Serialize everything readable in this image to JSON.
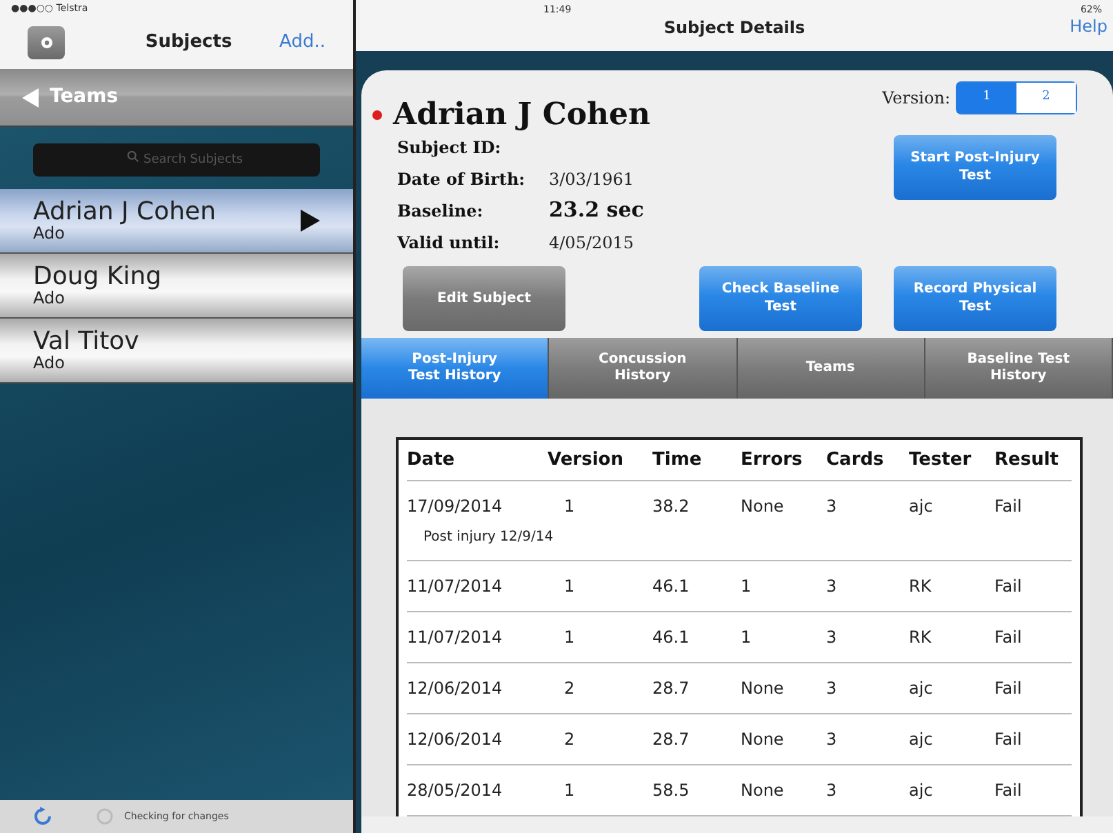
{
  "status_bar": {
    "carrier": "●●●○○ Telstra",
    "time": "11:49",
    "battery": "62%"
  },
  "sidebar": {
    "title": "Subjects",
    "add_button": "Add..",
    "back_button": "Teams",
    "search": {
      "placeholder": "Search Subjects"
    },
    "subjects": [
      {
        "name": "Adrian J Cohen",
        "team": "Ado",
        "selected": true
      },
      {
        "name": "Doug King",
        "team": "Ado",
        "selected": false
      },
      {
        "name": "Val Titov",
        "team": "Ado",
        "selected": false
      }
    ],
    "footer": {
      "status": "Checking for changes"
    }
  },
  "detail": {
    "title": "Subject Details",
    "help": "Help",
    "subject_name": "Adrian J Cohen",
    "version_label": "Version:",
    "versions": [
      {
        "label": "1",
        "selected": true
      },
      {
        "label": "2",
        "selected": false
      }
    ],
    "fields": [
      {
        "label": "Subject ID:"
      },
      {
        "label": "Date of Birth:",
        "value": "3/03/1961",
        "kind": "plain"
      },
      {
        "label": "Baseline:",
        "value": "23.2 sec",
        "kind": "bold"
      },
      {
        "label": "Valid until:",
        "value": "4/05/2015",
        "kind": "plain"
      }
    ],
    "start_button": "Start Post-Injury Test",
    "edit_button": "Edit Subject",
    "check_button": "Check Baseline Test",
    "record_button": "Record Physical Test",
    "tabs": [
      {
        "label": "Post-Injury Test History",
        "selected": true
      },
      {
        "label": "Concussion History",
        "selected": false
      },
      {
        "label": "Teams",
        "selected": false
      },
      {
        "label": "Baseline Test History",
        "selected": false
      }
    ],
    "table": {
      "columns": [
        "Date",
        "Version",
        "Time",
        "Errors",
        "Cards",
        "Tester",
        "Result"
      ],
      "rows": [
        {
          "cells": [
            "17/09/2014",
            "1",
            "38.2",
            "None",
            "3",
            "ajc",
            "Fail"
          ],
          "note": "Post injury 12/9/14"
        },
        {
          "cells": [
            "11/07/2014",
            "1",
            "46.1",
            "1",
            "3",
            "RK",
            "Fail"
          ]
        },
        {
          "cells": [
            "11/07/2014",
            "1",
            "46.1",
            "1",
            "3",
            "RK",
            "Fail"
          ]
        },
        {
          "cells": [
            "12/06/2014",
            "2",
            "28.7",
            "None",
            "3",
            "ajc",
            "Fail"
          ]
        },
        {
          "cells": [
            "12/06/2014",
            "2",
            "28.7",
            "None",
            "3",
            "ajc",
            "Fail"
          ]
        },
        {
          "cells": [
            "28/05/2014",
            "1",
            "58.5",
            "None",
            "3",
            "ajc",
            "Fail"
          ]
        }
      ]
    }
  }
}
